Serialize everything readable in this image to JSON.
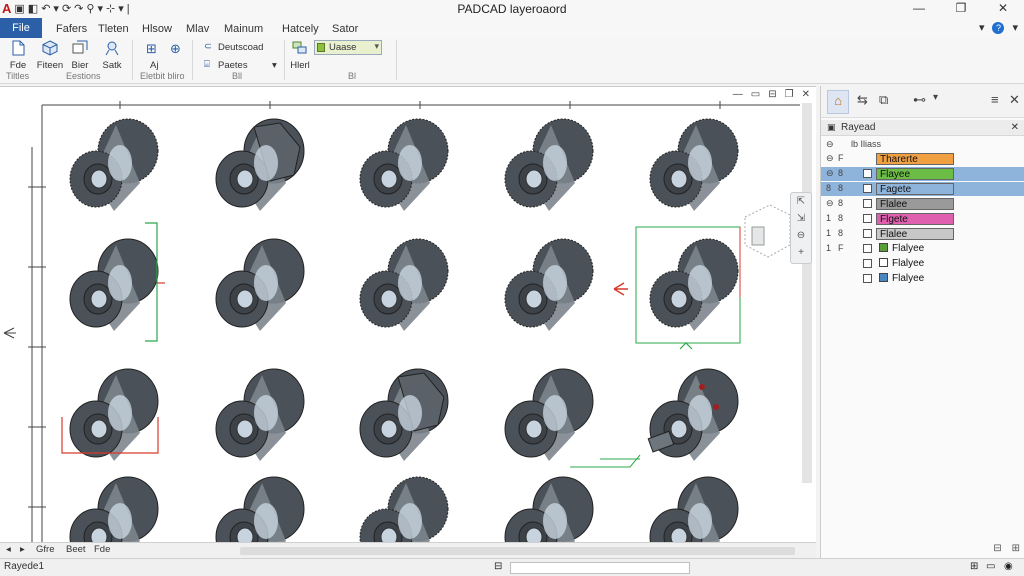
{
  "app": {
    "title": "PADCAD layeroaord",
    "quick_access": [
      "A",
      "▣",
      "◧",
      "↶",
      "▾",
      "⟳",
      "↷",
      "⚲",
      "▾",
      "⊹",
      "▾",
      "|"
    ]
  },
  "window_controls": {
    "minimize": "—",
    "restore": "❐",
    "close": "✕"
  },
  "menu": {
    "file": "File",
    "tabs": [
      "Fafers",
      "Tleten",
      "Hlsow",
      "Mlav",
      "Mainum",
      "Hatcely",
      "Sator"
    ],
    "right_items": [
      "▾",
      "?",
      "▾"
    ]
  },
  "ribbon": {
    "buttons": [
      {
        "label": "Fde",
        "icon": "file-icon"
      },
      {
        "label": "Fiteen",
        "icon": "cube-icon"
      },
      {
        "label": "Bier",
        "icon": "layers-icon"
      },
      {
        "label": "Satk",
        "icon": "select-icon"
      }
    ],
    "edit": {
      "small1": "⊞",
      "small2": "⊕",
      "label": "Aj"
    },
    "draw_items": [
      "Deutscoad",
      "Paetes"
    ],
    "draw_dropdown": "▾",
    "layer_button": "Hlerl",
    "combo_value": "Uaase",
    "groups": [
      "Tiltles",
      "Eestions",
      "Eletbit bliro",
      "Bll",
      "Bl"
    ]
  },
  "document_controls": [
    "—",
    "▭",
    "⊟",
    "❐",
    "✕"
  ],
  "navbar": [
    "⇱",
    "⇲",
    "⊖",
    "+"
  ],
  "bottom_tabs": [
    "◂",
    "▸",
    "Gfre",
    "Beet",
    "Fde"
  ],
  "status": {
    "text": "Rayede1",
    "icons": [
      "⊟",
      "⊞",
      "▭",
      "◉"
    ]
  },
  "panel": {
    "tools": [
      "⌂",
      "⇆",
      "⧉",
      "⊷",
      "▾",
      "≡",
      "✕"
    ],
    "header": "Rayead",
    "header_close": "✕",
    "top_row": {
      "bullet": "⊖",
      "text": "lb Iliass"
    },
    "layers": [
      {
        "bullet": "⊖",
        "num": "F",
        "name": "Tharerte",
        "color": "#f0a040",
        "selected": false,
        "checked": false
      },
      {
        "bullet": "⊖",
        "num": "8",
        "name": "Flayee",
        "color": "#6cbd45",
        "selected": true,
        "checked": true
      },
      {
        "bullet": "8",
        "num": "8",
        "name": "Fagete",
        "color": "#8fb4dc",
        "selected": true,
        "checked": true
      },
      {
        "bullet": "⊖",
        "num": "8",
        "name": "Flalee",
        "color": "#9a9a9a",
        "selected": false,
        "checked": true
      },
      {
        "bullet": "1",
        "num": "8",
        "name": "Flgete",
        "color": "#e060b0",
        "selected": false,
        "checked": true
      },
      {
        "bullet": "1",
        "num": "8",
        "name": "Flalee",
        "color": "#c8c8c8",
        "selected": false,
        "checked": true
      },
      {
        "bullet": "1",
        "num": "F",
        "name": "Flalyee",
        "color": "#5a9e3a",
        "selected": false,
        "checked": true
      },
      {
        "bullet": "",
        "num": "",
        "name": "Flalyee",
        "color": "#ffffff",
        "selected": false,
        "checked": true
      },
      {
        "bullet": "",
        "num": "",
        "name": "Flalyee",
        "color": "#4a86c0",
        "selected": false,
        "checked": true
      }
    ],
    "footer": [
      "⊟",
      "⊞"
    ]
  },
  "parts": [
    [
      {
        "s": "gear"
      },
      {
        "s": "hex"
      },
      {
        "s": "gear"
      },
      {
        "s": "gear"
      },
      {
        "s": "gear"
      }
    ],
    [
      {
        "s": "plain"
      },
      {
        "s": "plain"
      },
      {
        "s": "gear"
      },
      {
        "s": "gear"
      },
      {
        "s": "gear"
      }
    ],
    [
      {
        "s": "plain"
      },
      {
        "s": "plain"
      },
      {
        "s": "hex"
      },
      {
        "s": "plain"
      },
      {
        "s": "shaft"
      }
    ],
    [
      {
        "s": "plain"
      },
      {
        "s": "plain"
      },
      {
        "s": "gear"
      },
      {
        "s": "plain"
      },
      {
        "s": "plain"
      }
    ]
  ],
  "colors": {
    "accent": "#2b5fa8",
    "part_dark": "#4a5158",
    "part_mid": "#7d858d",
    "bore": "#c7d3de",
    "dim_green": "#2aa84a",
    "dim_red": "#d83a2a"
  }
}
